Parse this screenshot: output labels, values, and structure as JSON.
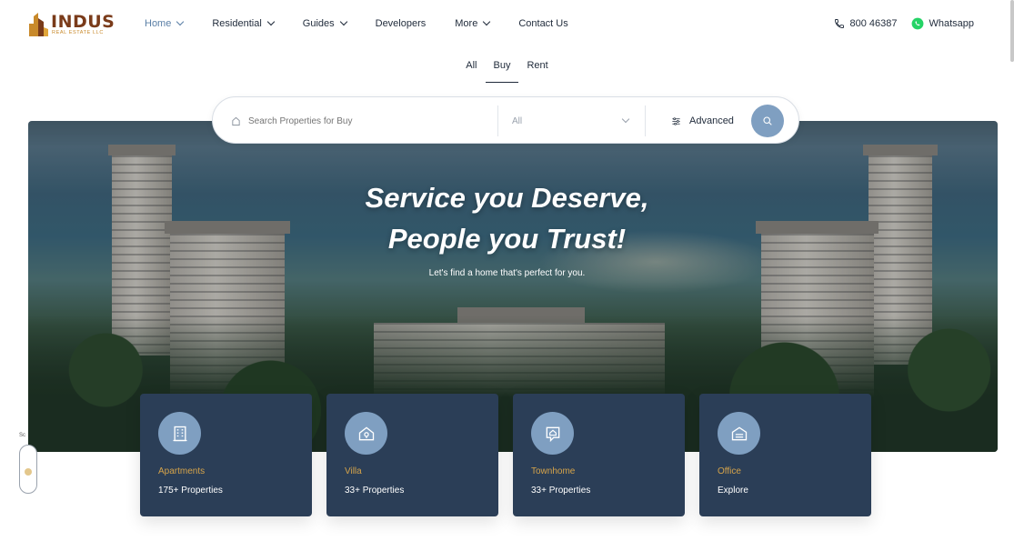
{
  "brand": {
    "name": "INDUS",
    "tagline": "REAL ESTATE LLC"
  },
  "nav": {
    "items": [
      {
        "label": "Home",
        "dropdown": true,
        "active": true
      },
      {
        "label": "Residential",
        "dropdown": true
      },
      {
        "label": "Guides",
        "dropdown": true
      },
      {
        "label": "Developers",
        "dropdown": false
      },
      {
        "label": "More",
        "dropdown": true
      },
      {
        "label": "Contact Us",
        "dropdown": false
      }
    ]
  },
  "contact": {
    "phone": "800 46387",
    "whatsapp": "Whatsapp"
  },
  "tabs": [
    {
      "label": "All"
    },
    {
      "label": "Buy",
      "active": true
    },
    {
      "label": "Rent"
    }
  ],
  "search": {
    "placeholder": "Search Properties for Buy",
    "type_value": "All",
    "advanced_label": "Advanced"
  },
  "hero": {
    "title_line1": "Service you Deserve,",
    "title_line2": "People you Trust!",
    "subtitle": "Let's find a home that's perfect for you."
  },
  "categories": [
    {
      "title": "Apartments",
      "count": "175+ Properties",
      "icon": "apartment-building-icon"
    },
    {
      "title": "Villa",
      "count": "33+ Properties",
      "icon": "villa-house-icon"
    },
    {
      "title": "Townhome",
      "count": "33+ Properties",
      "icon": "townhome-icon"
    },
    {
      "title": "Office",
      "count": "Explore",
      "icon": "office-icon"
    }
  ],
  "scroll_indicator": {
    "label": "Sc"
  },
  "colors": {
    "accent": "#7f9fc1",
    "card_bg": "#2b3e57",
    "card_title": "#d5a34a",
    "nav_active": "#5a7fa6",
    "brand": "#7a3b1a"
  }
}
